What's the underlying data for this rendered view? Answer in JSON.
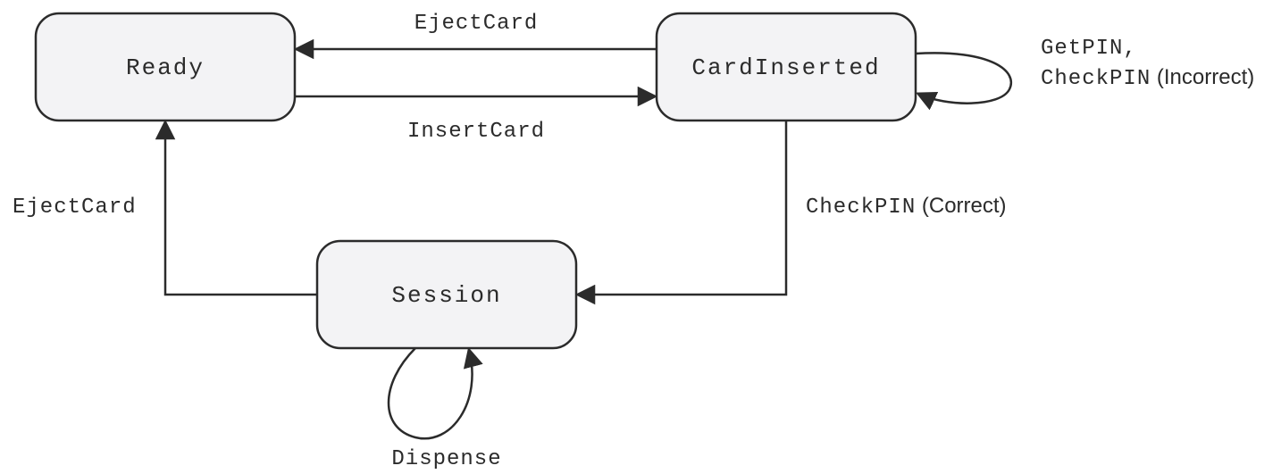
{
  "states": {
    "ready": "Ready",
    "cardInserted": "CardInserted",
    "session": "Session"
  },
  "transitions": {
    "ejectCardTop": "EjectCard",
    "insertCard": "InsertCard",
    "getPinLine1": "GetPIN,",
    "checkPinIncorrectMono": "CheckPIN",
    "checkPinIncorrectSans": " (Incorrect)",
    "checkPinCorrectMono": "CheckPIN",
    "checkPinCorrectSans": " (Correct)",
    "ejectCardLeft": "EjectCard",
    "dispense": "Dispense"
  }
}
